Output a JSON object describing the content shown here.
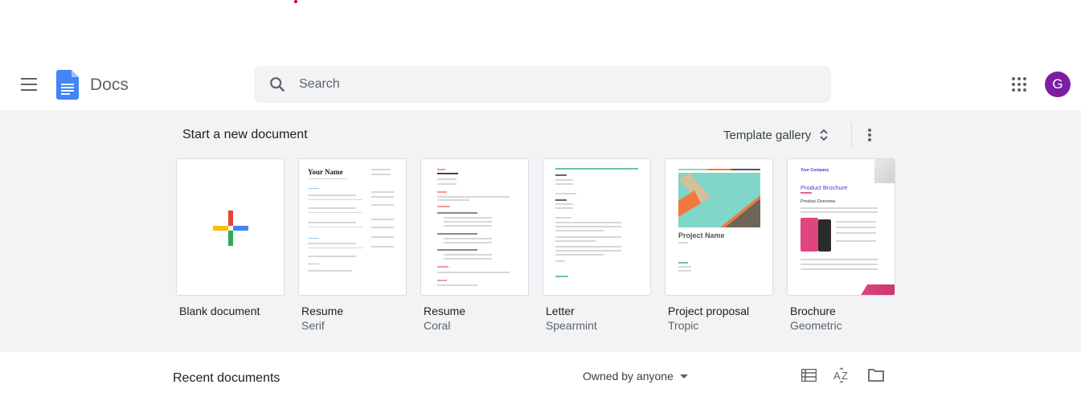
{
  "app": {
    "name": "Docs",
    "avatar_letter": "G",
    "avatar_color": "#7b1fa2"
  },
  "search": {
    "placeholder": "Search"
  },
  "templates": {
    "heading": "Start a new document",
    "gallery_label": "Template gallery",
    "items": [
      {
        "title": "Blank document",
        "subtitle": ""
      },
      {
        "title": "Resume",
        "subtitle": "Serif",
        "preview_heading": "Your Name"
      },
      {
        "title": "Resume",
        "subtitle": "Coral"
      },
      {
        "title": "Letter",
        "subtitle": "Spearmint"
      },
      {
        "title": "Project proposal",
        "subtitle": "Tropic",
        "preview_heading": "Project Name"
      },
      {
        "title": "Brochure",
        "subtitle": "Geometric",
        "preview_company": "Your Company",
        "preview_heading": "Product Brochure",
        "preview_section": "Product Overview"
      }
    ]
  },
  "recent": {
    "heading": "Recent documents",
    "owner_filter": "Owned by anyone"
  }
}
